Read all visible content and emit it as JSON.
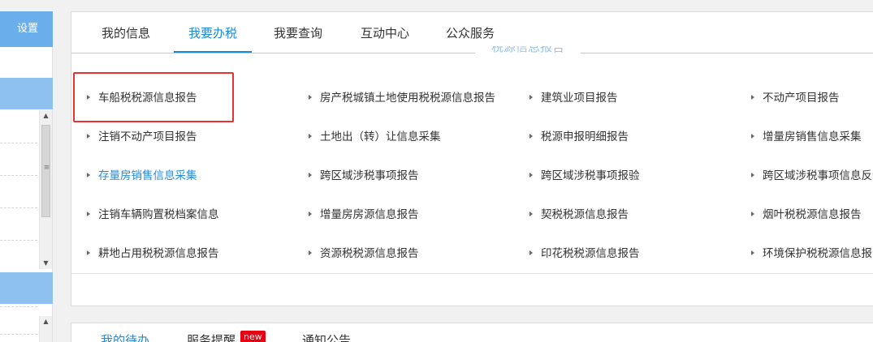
{
  "sidebar": {
    "setting_label": "设置"
  },
  "tabs": [
    {
      "label": "我的信息",
      "active": false
    },
    {
      "label": "我要办税",
      "active": true
    },
    {
      "label": "我要查询",
      "active": false
    },
    {
      "label": "互动中心",
      "active": false
    },
    {
      "label": "公众服务",
      "active": false
    }
  ],
  "section_title": "税源信息报告",
  "items": [
    "车船税税源信息报告",
    "房产税城镇土地使用税税源信息报告",
    "建筑业项目报告",
    "不动产项目报告",
    "注销不动产项目报告",
    "土地出（转）让信息采集",
    "税源申报明细报告",
    "增量房销售信息采集",
    "存量房销售信息采集",
    "跨区域涉税事项报告",
    "跨区域涉税事项报验",
    "跨区域涉税事项信息反馈",
    "注销车辆购置税档案信息",
    "增量房房源信息报告",
    "契税税源信息报告",
    "烟叶税税源信息报告",
    "耕地占用税税源信息报告",
    "资源税税源信息报告",
    "印花税税源信息报告",
    "环境保护税税源信息报告"
  ],
  "highlighted_item": "车船税税源信息报告",
  "link_color_item": "存量房销售信息采集",
  "bottom_tabs": [
    {
      "label": "我的待办",
      "active": true
    },
    {
      "label": "服务提醒",
      "active": false
    },
    {
      "label": "通知公告",
      "active": false
    }
  ],
  "new_badge": "new",
  "colors": {
    "accent": "#1a8ad8",
    "sidebar_blue": "#6aaeec",
    "highlight_red": "#e63232",
    "badge_red": "#e60012"
  }
}
